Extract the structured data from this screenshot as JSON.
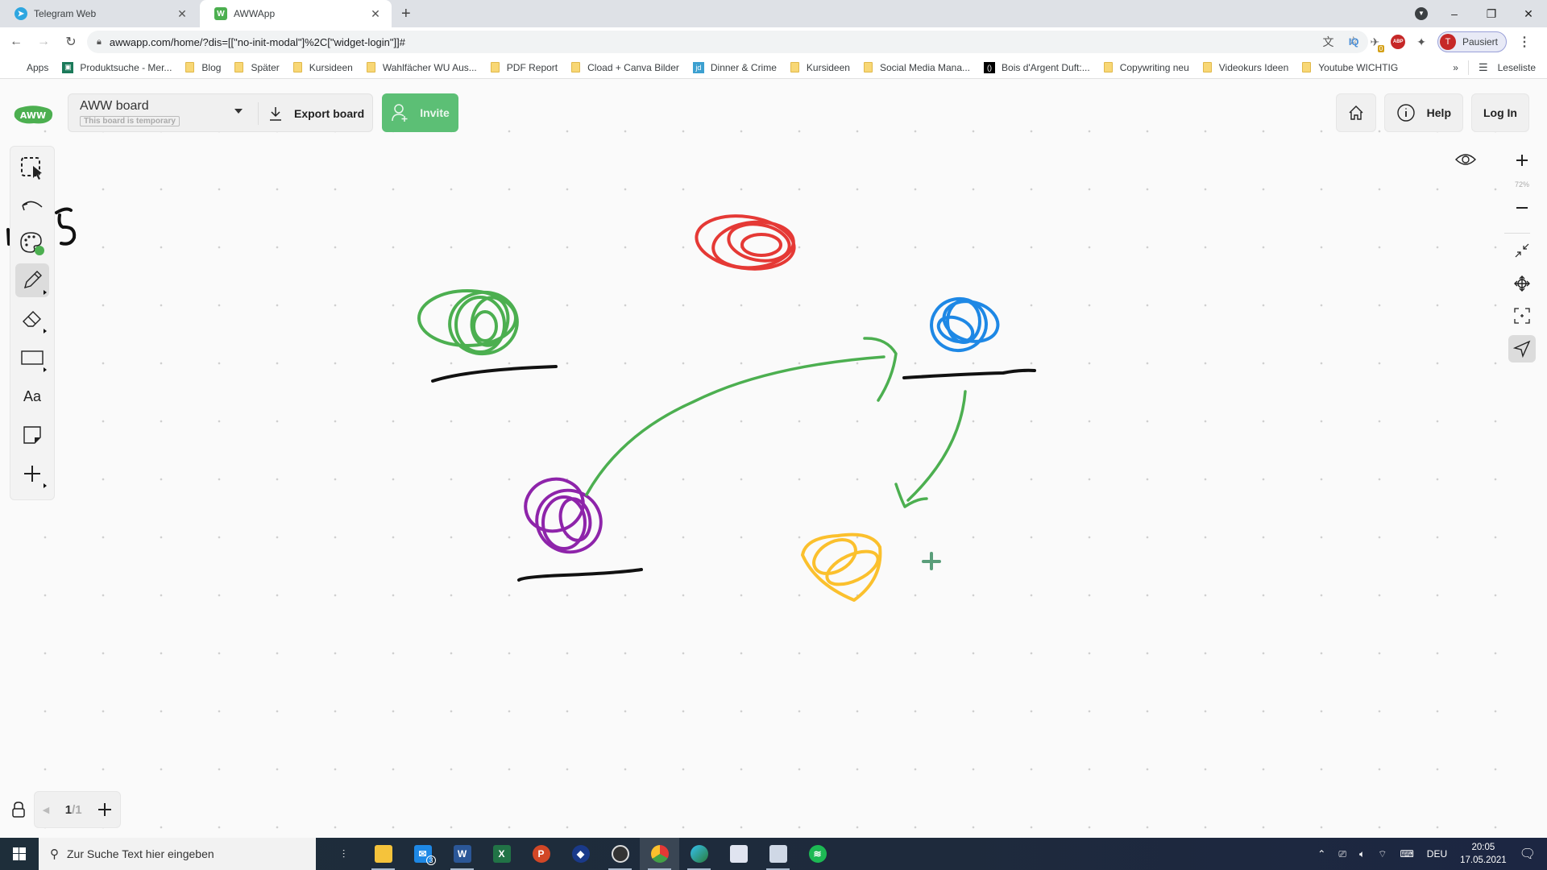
{
  "browser": {
    "tabs": [
      {
        "title": "Telegram Web",
        "icon": "telegram-icon",
        "active": false
      },
      {
        "title": "AWWApp",
        "icon": "awwapp-icon",
        "active": true
      }
    ],
    "new_tab_label": "+",
    "window_controls": {
      "minimize": "–",
      "restore": "❐",
      "close": "✕"
    },
    "url": "awwapp.com/home/?dis=[[\"no-init-modal\"]%2C[\"widget-login\"]]#",
    "extensions": {
      "iq": "IQ",
      "badge_count": "0",
      "abp": "ABP"
    },
    "profile": {
      "initial": "T",
      "status": "Pausiert"
    },
    "bookmarks": [
      {
        "label": "Apps",
        "type": "apps"
      },
      {
        "label": "Produktsuche - Mer...",
        "type": "site"
      },
      {
        "label": "Blog",
        "type": "folder"
      },
      {
        "label": "Später",
        "type": "folder"
      },
      {
        "label": "Kursideen",
        "type": "folder"
      },
      {
        "label": "Wahlfächer WU Aus...",
        "type": "folder"
      },
      {
        "label": "PDF Report",
        "type": "folder"
      },
      {
        "label": "Cload + Canva Bilder",
        "type": "folder"
      },
      {
        "label": "Dinner & Crime",
        "type": "site-jd"
      },
      {
        "label": "Kursideen",
        "type": "folder"
      },
      {
        "label": "Social Media Mana...",
        "type": "folder"
      },
      {
        "label": "Bois d'Argent Duft:...",
        "type": "site-dark"
      },
      {
        "label": "Copywriting neu",
        "type": "folder"
      },
      {
        "label": "Videokurs Ideen",
        "type": "folder"
      },
      {
        "label": "Youtube WICHTIG",
        "type": "folder"
      }
    ],
    "bookmarks_overflow": "»",
    "reading_list": "Leseliste"
  },
  "app": {
    "logo_text": "AWW",
    "board": {
      "name": "AWW board",
      "temporary_label": "This board is temporary"
    },
    "export_label": "Export board",
    "invite_label": "Invite",
    "help_label": "Help",
    "login_label": "Log In",
    "zoom_level": "72%",
    "page": {
      "current": "1",
      "total": "/1"
    },
    "tools": [
      {
        "name": "select-tool",
        "active": false
      },
      {
        "name": "undo-tool",
        "active": false
      },
      {
        "name": "color-palette-tool",
        "active": false,
        "color": "#4caf50"
      },
      {
        "name": "pencil-tool",
        "active": true
      },
      {
        "name": "eraser-tool",
        "active": false
      },
      {
        "name": "shape-tool",
        "active": false
      },
      {
        "name": "text-tool",
        "active": false,
        "label": "Aa"
      },
      {
        "name": "sticky-note-tool",
        "active": false
      },
      {
        "name": "add-tool",
        "active": false
      }
    ],
    "drawing_colors": {
      "red": "#e53935",
      "green": "#4caf50",
      "blue": "#1e88e5",
      "purple": "#8e24aa",
      "yellow": "#fbc02d",
      "black": "#111111",
      "brand": "#5cbf75"
    }
  },
  "taskbar": {
    "search_placeholder": "Zur Suche Text hier eingeben",
    "mail_badge": "3",
    "language": "DEU",
    "time": "20:05",
    "date": "17.05.2021"
  }
}
